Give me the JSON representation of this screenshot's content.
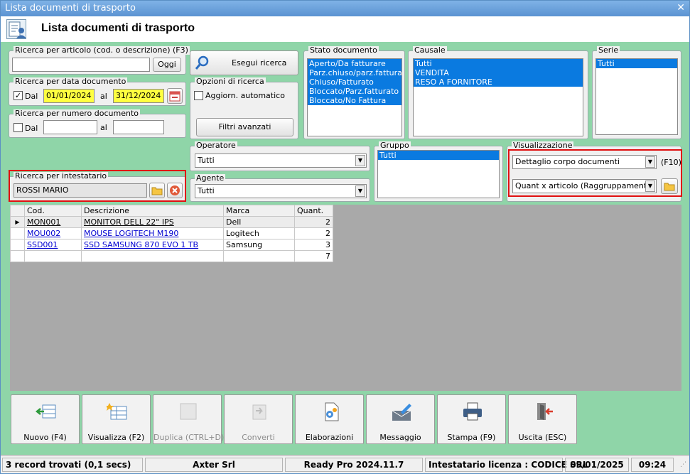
{
  "window": {
    "titlebar": "Lista documenti di trasporto",
    "close_glyph": "✕"
  },
  "header": {
    "title": "Lista documenti di trasporto",
    "icon": "document-list-user-icon"
  },
  "search_article": {
    "title": "Ricerca per articolo (cod. o descrizione) (F3)",
    "value": "",
    "button": "Oggi"
  },
  "search_date": {
    "title": "Ricerca per data documento",
    "checked": true,
    "dal_label": "Dal",
    "from": "01/01/2024",
    "al_label": "al",
    "to": "31/12/2024"
  },
  "search_number": {
    "title": "Ricerca per numero documento",
    "checked": false,
    "dal_label": "Dal",
    "from": "",
    "al_label": "al",
    "to": ""
  },
  "search_holder": {
    "title": "Ricerca per intestatario",
    "value": "ROSSI MARIO"
  },
  "search_button": {
    "label": "Esegui ricerca"
  },
  "options": {
    "title": "Opzioni di ricerca",
    "auto_update_label": "Aggiorn. automatico",
    "auto_update_checked": false,
    "advanced_filters": "Filtri avanzati"
  },
  "operator": {
    "title": "Operatore",
    "value": "Tutti"
  },
  "agent": {
    "title": "Agente",
    "value": "Tutti"
  },
  "status_doc": {
    "title": "Stato documento",
    "items": [
      "Aperto/Da fatturare",
      "Parz.chiuso/parz.fatturato",
      "Chiuso/Fatturato",
      "Bloccato/Parz.fatturato",
      "Bloccato/No Fattura"
    ]
  },
  "causale": {
    "title": "Causale",
    "items": [
      "Tutti",
      "VENDITA",
      "RESO A FORNITORE"
    ]
  },
  "serie": {
    "title": "Serie",
    "items": [
      "Tutti"
    ]
  },
  "gruppo": {
    "title": "Gruppo",
    "items": [
      "Tutti"
    ]
  },
  "visualizzazione": {
    "title": "Visualizzazione",
    "mode": "Dettaglio corpo documenti",
    "shortcut": "(F10)",
    "grouping": "Quant x articolo (Raggruppamento)"
  },
  "grid": {
    "columns": [
      "Cod.",
      "Descrizione",
      "Marca",
      "Quant."
    ],
    "rows": [
      {
        "code": "MON001",
        "description": "MONITOR DELL 22\" IPS",
        "brand": "Dell",
        "qty": "2"
      },
      {
        "code": "MOU002",
        "description": "MOUSE LOGITECH M190",
        "brand": "Logitech",
        "qty": "2"
      },
      {
        "code": "SSD001",
        "description": "SSD SAMSUNG 870 EVO 1 TB",
        "brand": "Samsung",
        "qty": "3"
      }
    ],
    "total_qty": "7"
  },
  "toolbar": {
    "nuovo": "Nuovo (F4)",
    "visualizza": "Visualizza (F2)",
    "duplica": "Duplica (CTRL+D)",
    "converti": "Converti",
    "elaborazioni": "Elaborazioni",
    "messaggio": "Messaggio",
    "stampa": "Stampa (F9)",
    "uscita": "Uscita (ESC)"
  },
  "statusbar": {
    "records": "3 record trovati (0,1 secs)",
    "company": "Axter Srl",
    "version": "Ready Pro 2024.11.7",
    "license": "Intestatario licenza : CODICE SRL",
    "date": "09/01/2025",
    "time": "09:24"
  },
  "colors": {
    "background": "#8fd5a8",
    "selection": "#0a7ae0",
    "highlight_border": "#e01010",
    "date_field": "#ffff40"
  }
}
